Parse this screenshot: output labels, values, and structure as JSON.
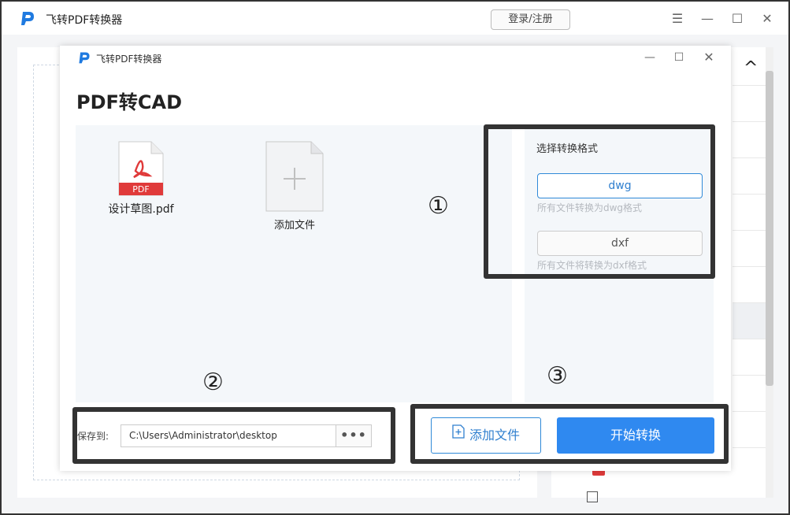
{
  "app": {
    "title": "飞转PDF转换器",
    "login_label": "登录/注册"
  },
  "dialog": {
    "title": "飞转PDF转换器",
    "page_title": "PDF转CAD",
    "files": [
      {
        "name": "设计草图.pdf",
        "icon": "pdf-file-icon",
        "badge": "PDF"
      }
    ],
    "add_file_tile_label": "添加文件",
    "format": {
      "label": "选择转换格式",
      "options": [
        {
          "label": "dwg",
          "desc": "所有文件转换为dwg格式",
          "selected": true
        },
        {
          "label": "dxf",
          "desc": "所有文件将转换为dxf格式",
          "selected": false
        }
      ]
    },
    "save": {
      "label": "保存到:",
      "path": "C:\\Users\\Administrator\\desktop",
      "more_label": "•••"
    },
    "buttons": {
      "add_file": "添加文件",
      "start": "开始转换"
    }
  },
  "annotations": [
    "①",
    "②",
    "③"
  ],
  "colors": {
    "accent": "#2f89f0",
    "pdf_red": "#e03a3a",
    "annotation": "#333333"
  }
}
